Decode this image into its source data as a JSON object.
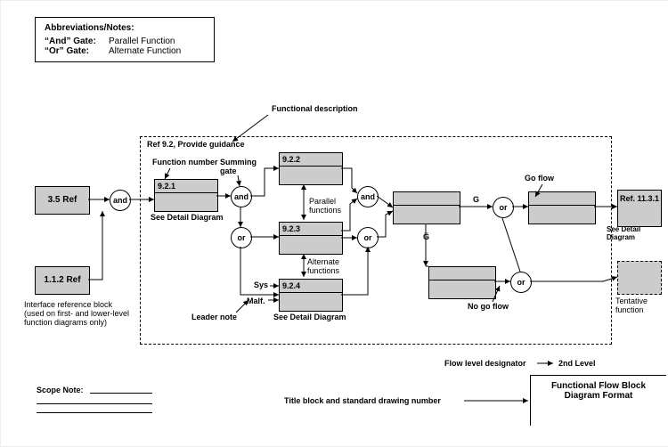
{
  "notes": {
    "heading": "Abbreviations/Notes:",
    "l1a": "“And” Gate:",
    "l1b": "Parallel Function",
    "l2a": "“Or” Gate:",
    "l2b": "Alternate Function"
  },
  "annotations": {
    "func_desc": "Functional description",
    "context_title": "Ref 9.2, Provide guidance",
    "func_number": "Function number",
    "summing_gate": "Summing gate",
    "see_detail": "See Detail Diagram",
    "parallel": "Parallel functions",
    "alternate": "Alternate functions",
    "sys": "Sys",
    "malf": "Malf.",
    "leader_note": "Leader note",
    "go_flow": "Go flow",
    "no_go_flow": "No go flow",
    "g": "G",
    "g_bar": "G̅",
    "tentative": "Tentative function",
    "iref_note": "Interface reference block (used on first- and lower-level function diagrams only)",
    "scope": "Scope Note:",
    "flow_level_lbl": "Flow level designator",
    "flow_level_val": "2nd Level",
    "titleblk_lbl": "Title block and standard drawing number",
    "titleblk_val": "Functional Flow Block Diagram Format"
  },
  "blocks": {
    "b35": "3.5 Ref",
    "b112": "1.1.2 Ref",
    "b921": "9.2.1",
    "b922": "9.2.2",
    "b923": "9.2.3",
    "b924": "9.2.4",
    "out_ref": "Ref. 11.3.1"
  },
  "gates": {
    "and": "and",
    "or": "or"
  }
}
